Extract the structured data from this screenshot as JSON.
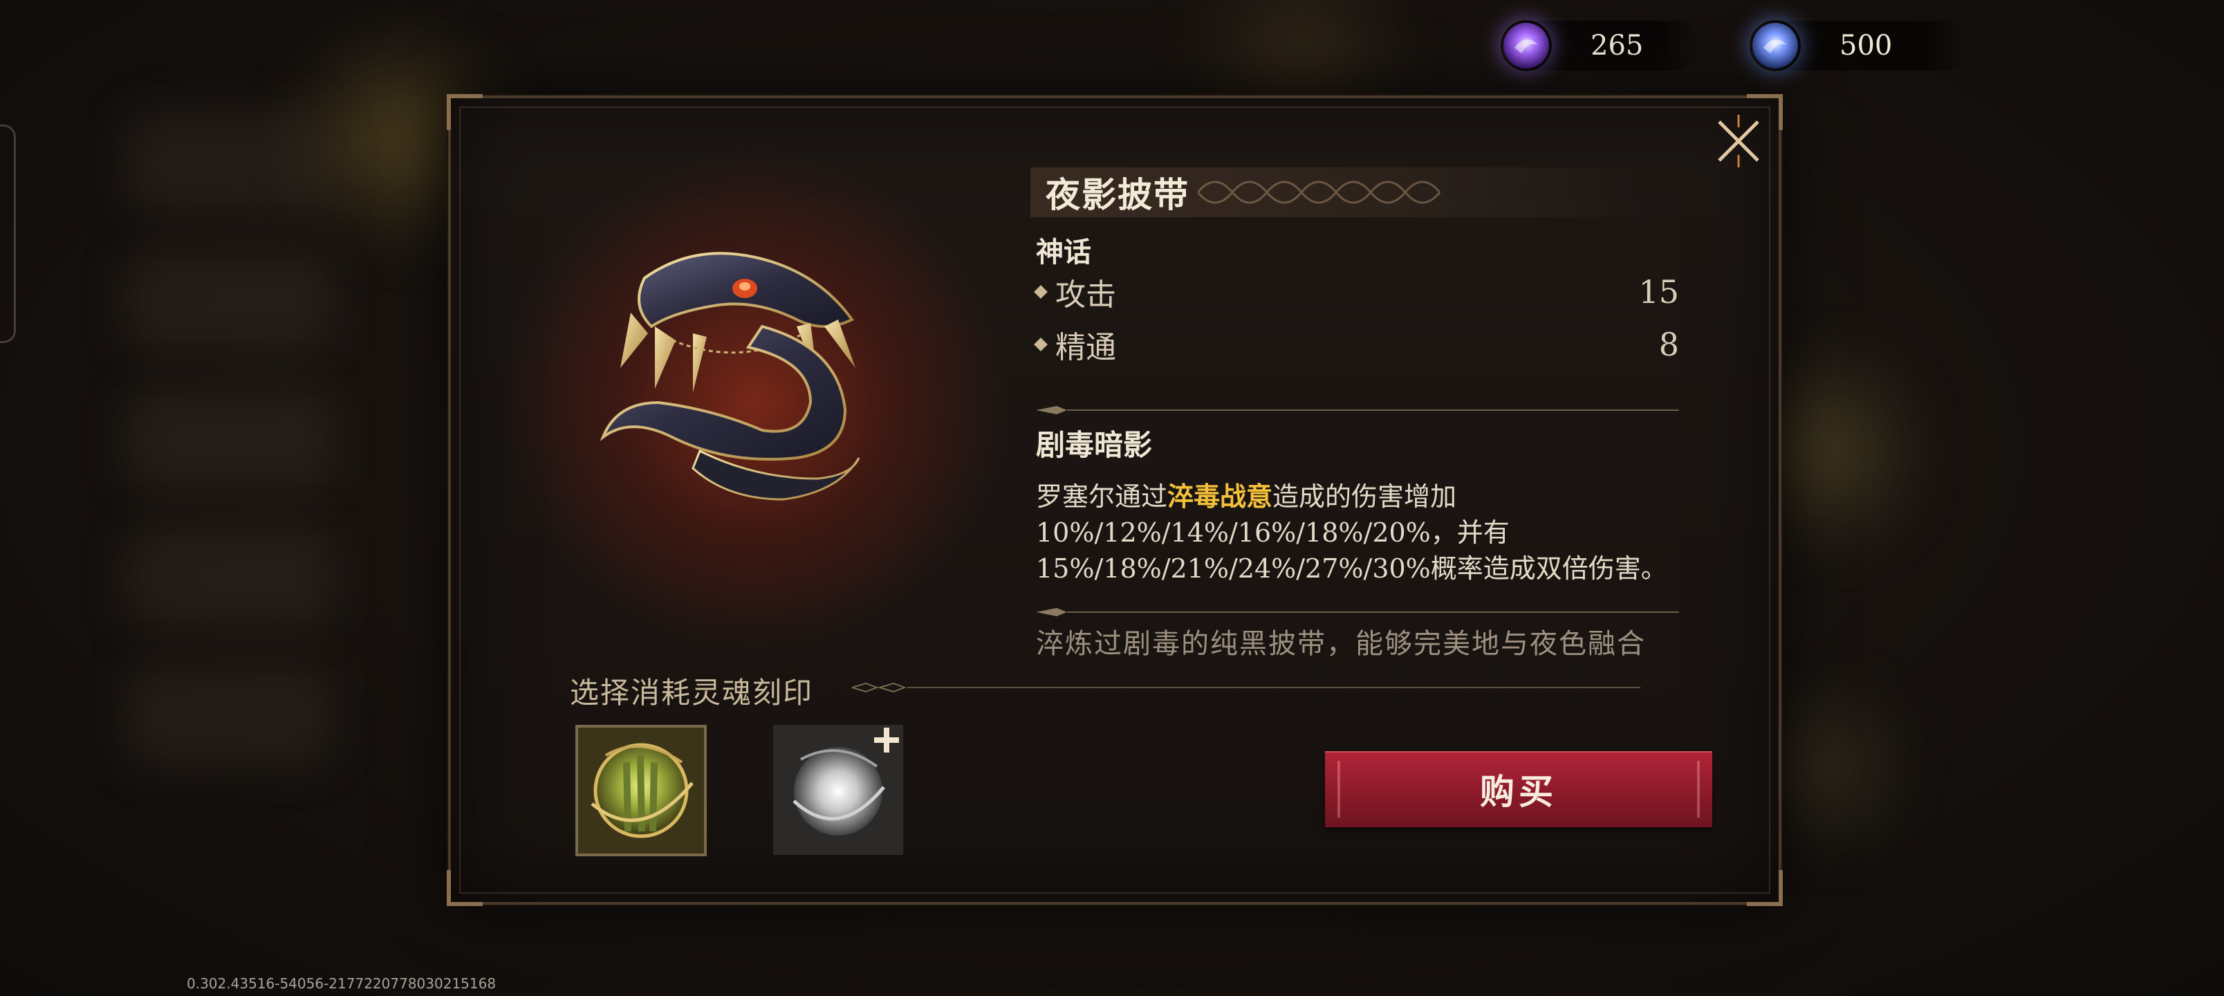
{
  "currencies": [
    {
      "icon": "purple-soul-orb-icon",
      "value": "265",
      "color": "#9a5bff"
    },
    {
      "icon": "blue-soul-orb-icon",
      "value": "500",
      "color": "#6b8cff"
    }
  ],
  "modal": {
    "item_name": "夜影披带",
    "rarity": "神话",
    "stats": [
      {
        "label": "攻击",
        "value": "15"
      },
      {
        "label": "精通",
        "value": "8"
      }
    ],
    "skill": {
      "title": "剧毒暗影",
      "desc_prefix": "罗塞尔通过",
      "desc_highlight": "淬毒战意",
      "desc_suffix": "造成的伤害增加",
      "desc_line2": "10%/12%/14%/16%/18%/20%，并有",
      "desc_line3": "15%/18%/21%/24%/27%/30%概率造成双倍伤害。"
    },
    "flavor": "淬炼过剧毒的纯黑披带，能够完美地与夜色融合",
    "imprint_title": "选择消耗灵魂刻印",
    "buy_label": "购买"
  },
  "debug_text": "0.302.43516-54056-2177220778030215168",
  "colors": {
    "accent_highlight": "#f5c13a",
    "buy_button": "#9d1f31",
    "frame": "#4a3a2c"
  }
}
